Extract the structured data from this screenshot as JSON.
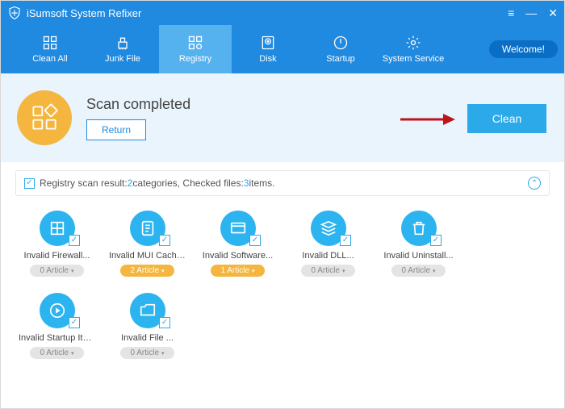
{
  "titlebar": {
    "title": "iSumsoft System Refixer"
  },
  "nav": {
    "items": [
      {
        "label": "Clean All"
      },
      {
        "label": "Junk File"
      },
      {
        "label": "Registry"
      },
      {
        "label": "Disk"
      },
      {
        "label": "Startup"
      },
      {
        "label": "System Service"
      }
    ],
    "activeIndex": 2,
    "welcome": "Welcome!"
  },
  "header": {
    "heading": "Scan completed",
    "return": "Return",
    "clean": "Clean"
  },
  "resultBar": {
    "p1": "Registry scan result: ",
    "c1": "2",
    "p2": " categories, Checked files: ",
    "c2": "3",
    "p3": " items."
  },
  "cards": [
    {
      "label": "Invalid Firewall...",
      "badge": "0 Article",
      "hot": false
    },
    {
      "label": "Invalid MUI Cache...",
      "badge": "2 Article",
      "hot": true
    },
    {
      "label": "Invalid Software...",
      "badge": "1 Article",
      "hot": true
    },
    {
      "label": "Invalid DLL...",
      "badge": "0 Article",
      "hot": false
    },
    {
      "label": "Invalid Uninstall...",
      "badge": "0 Article",
      "hot": false
    },
    {
      "label": "Invalid Startup Item...",
      "badge": "0 Article",
      "hot": false
    },
    {
      "label": "Invalid File ...",
      "badge": "0 Article",
      "hot": false
    }
  ]
}
